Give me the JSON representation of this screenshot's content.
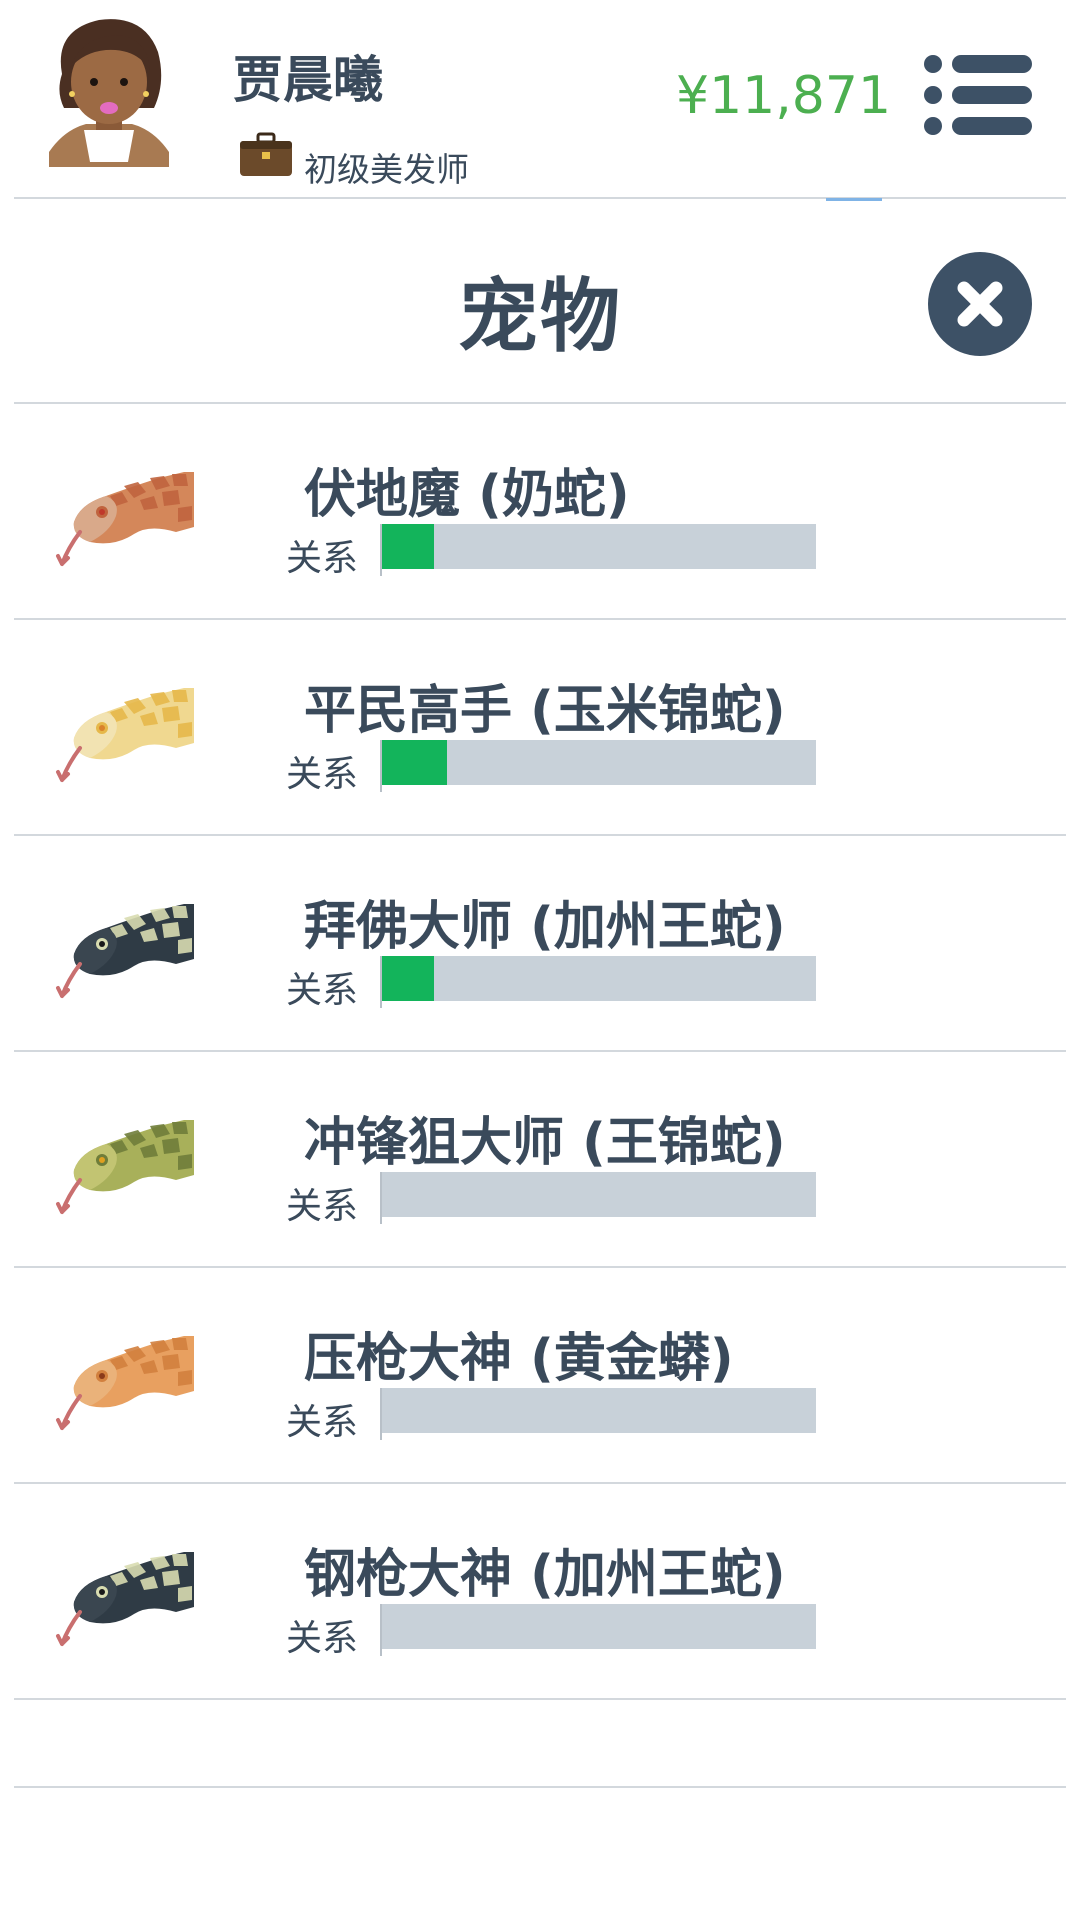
{
  "header": {
    "player_name": "贾晨曦",
    "job_title": "初级美发师",
    "money": "¥11,871",
    "avatar_icon": "female-avatar-icon",
    "job_icon": "briefcase-icon",
    "menu_icon": "menu-list-icon"
  },
  "modal": {
    "title": "宠物",
    "close_icon": "close-icon"
  },
  "colors": {
    "text": "#3a4a5b",
    "money": "#4caf50",
    "relationship_fill": "#13b45b",
    "relationship_track": "#c8d1d9",
    "button_dark": "#3d5166"
  },
  "pets": [
    {
      "name": "伏地魔 (奶蛇)",
      "relationship_label": "关系",
      "relationship_level": 0.12,
      "snake_icon": "milk-snake-icon"
    },
    {
      "name": "平民高手 (玉米锦蛇)",
      "relationship_label": "关系",
      "relationship_level": 0.15,
      "snake_icon": "corn-snake-icon"
    },
    {
      "name": "拜佛大师 (加州王蛇)",
      "relationship_label": "关系",
      "relationship_level": 0.12,
      "snake_icon": "california-kingsnake-icon"
    },
    {
      "name": "冲锋狙大师 (王锦蛇)",
      "relationship_label": "关系",
      "relationship_level": 0.0,
      "snake_icon": "king-ratsnake-icon"
    },
    {
      "name": "压枪大神 (黄金蟒)",
      "relationship_label": "关系",
      "relationship_level": 0.0,
      "snake_icon": "golden-python-icon"
    },
    {
      "name": "钢枪大神 (加州王蛇)",
      "relationship_label": "关系",
      "relationship_level": 0.0,
      "snake_icon": "california-kingsnake-icon"
    }
  ]
}
